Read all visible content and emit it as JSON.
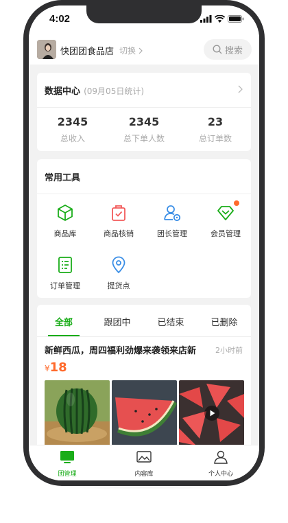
{
  "status": {
    "time": "4:02"
  },
  "header": {
    "store_name": "快团团食品店",
    "switch_label": "切换",
    "search_label": "搜索"
  },
  "data_center": {
    "title": "数据中心",
    "subtitle": "(09月05日统计)",
    "stats": [
      {
        "value": "2345",
        "label": "总收入"
      },
      {
        "value": "2345",
        "label": "总下单人数"
      },
      {
        "value": "23",
        "label": "总订单数"
      }
    ]
  },
  "tools": {
    "title": "常用工具",
    "items": [
      {
        "label": "商品库",
        "icon": "cube-icon"
      },
      {
        "label": "商品核销",
        "icon": "bag-check-icon"
      },
      {
        "label": "团长管理",
        "icon": "leader-icon"
      },
      {
        "label": "会员管理",
        "icon": "member-diamond-icon"
      },
      {
        "label": "订单管理",
        "icon": "order-list-icon"
      },
      {
        "label": "提货点",
        "icon": "location-pin-icon"
      }
    ]
  },
  "feed": {
    "tabs": [
      "全部",
      "跟团中",
      "已结束",
      "已删除"
    ],
    "active_tab": 0,
    "post": {
      "title": "新鲜西瓜，周四福利劲爆来袭领来店新",
      "time": "2小时前",
      "currency": "¥",
      "price": "18"
    }
  },
  "tabbar": {
    "items": [
      {
        "label": "团管理",
        "icon": "group-manage-icon"
      },
      {
        "label": "内容库",
        "icon": "image-library-icon"
      },
      {
        "label": "个人中心",
        "icon": "profile-icon"
      }
    ],
    "active": 0
  },
  "colors": {
    "accent": "#1aad19",
    "price": "#ff6a2c",
    "tool_green": "#1aad19",
    "tool_red": "#f25a5a",
    "tool_blue": "#3a8ee6"
  }
}
